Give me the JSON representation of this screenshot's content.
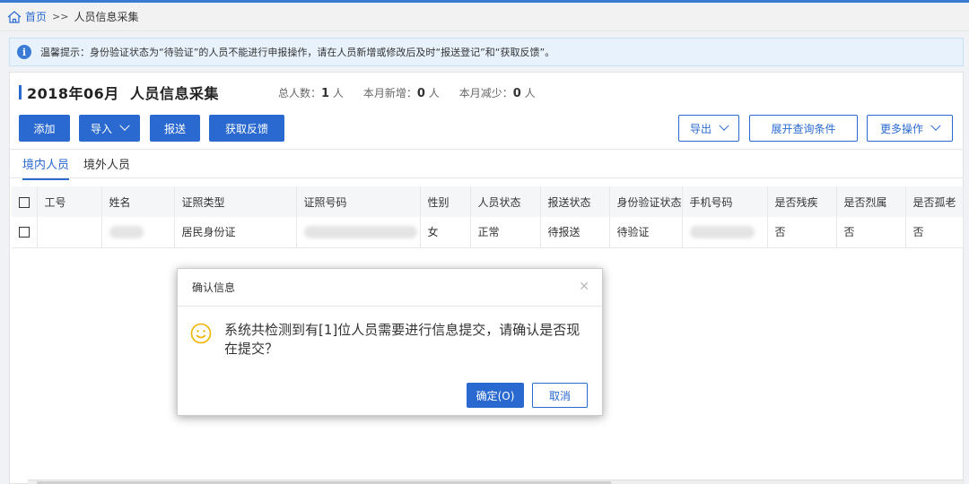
{
  "breadcrumb": {
    "home": "首页",
    "separator": ">>",
    "current": "人员信息采集"
  },
  "tip": {
    "text": "温馨提示：身份验证状态为“待验证”的人员不能进行申报操作，请在人员新增或修改后及时“报送登记”和“获取反馈”。"
  },
  "header": {
    "title": "2018年06月  人员信息采集",
    "stats": [
      {
        "label": "总人数：",
        "value": "1",
        "unit": " 人"
      },
      {
        "label": "本月新增：",
        "value": "0",
        "unit": " 人"
      },
      {
        "label": "本月减少：",
        "value": "0",
        "unit": " 人"
      }
    ]
  },
  "toolbar": {
    "add": "添加",
    "import": "导入",
    "submit": "报送",
    "feedback": "获取反馈",
    "export": "导出",
    "expand_query": "展开查询条件",
    "more": "更多操作"
  },
  "tabs": [
    {
      "label": "境内人员",
      "active": true
    },
    {
      "label": "境外人员",
      "active": false
    }
  ],
  "table": {
    "columns": [
      "工号",
      "姓名",
      "证照类型",
      "证照号码",
      "性别",
      "人员状态",
      "报送状态",
      "身份验证状态",
      "手机号码",
      "是否残疾",
      "是否烈属",
      "是否孤老"
    ],
    "rows": [
      {
        "employee_id": "",
        "id_type": "居民身份证",
        "gender": "女",
        "person_status": "正常",
        "submit_status": "待报送",
        "verify_status": "待验证",
        "disabled": "否",
        "martyr": "否",
        "lonely": "否"
      }
    ]
  },
  "dialog": {
    "title": "确认信息",
    "message": "系统共检测到有[1]位人员需要进行信息提交，请确认是否现在提交？",
    "confirm": "确定(O)",
    "cancel": "取消"
  },
  "colors": {
    "primary": "#2a6ad0",
    "tip_bg": "#e8f2fd",
    "smile": "#f0b400"
  }
}
